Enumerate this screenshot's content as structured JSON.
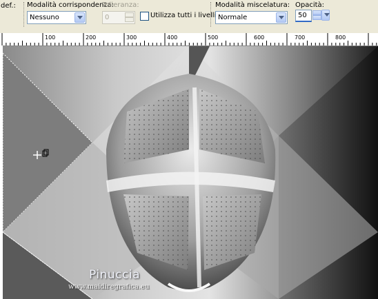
{
  "toolbar": {
    "def_label": "def.:",
    "match_mode": {
      "label": "Modalità corrispondenza:",
      "value": "Nessuno"
    },
    "tolerance": {
      "label": "Tolleranza:",
      "value": "0"
    },
    "use_all_layers": {
      "label": "Utilizza tutti i livelli",
      "checked": false
    },
    "blend_mode": {
      "label": "Modalità miscelatura:",
      "value": "Normale"
    },
    "opacity": {
      "label": "Opacità:",
      "value": "50"
    }
  },
  "ruler": {
    "ticks": [
      "100",
      "200",
      "300",
      "400",
      "500",
      "600",
      "700",
      "800"
    ]
  },
  "canvas": {
    "watermark_name": "Pinuccia",
    "watermark_url": "www.maidiregrafica.eu"
  },
  "colors": {
    "accent_blue": "#316ac5",
    "toolbar_bg": "#ece9d8"
  }
}
